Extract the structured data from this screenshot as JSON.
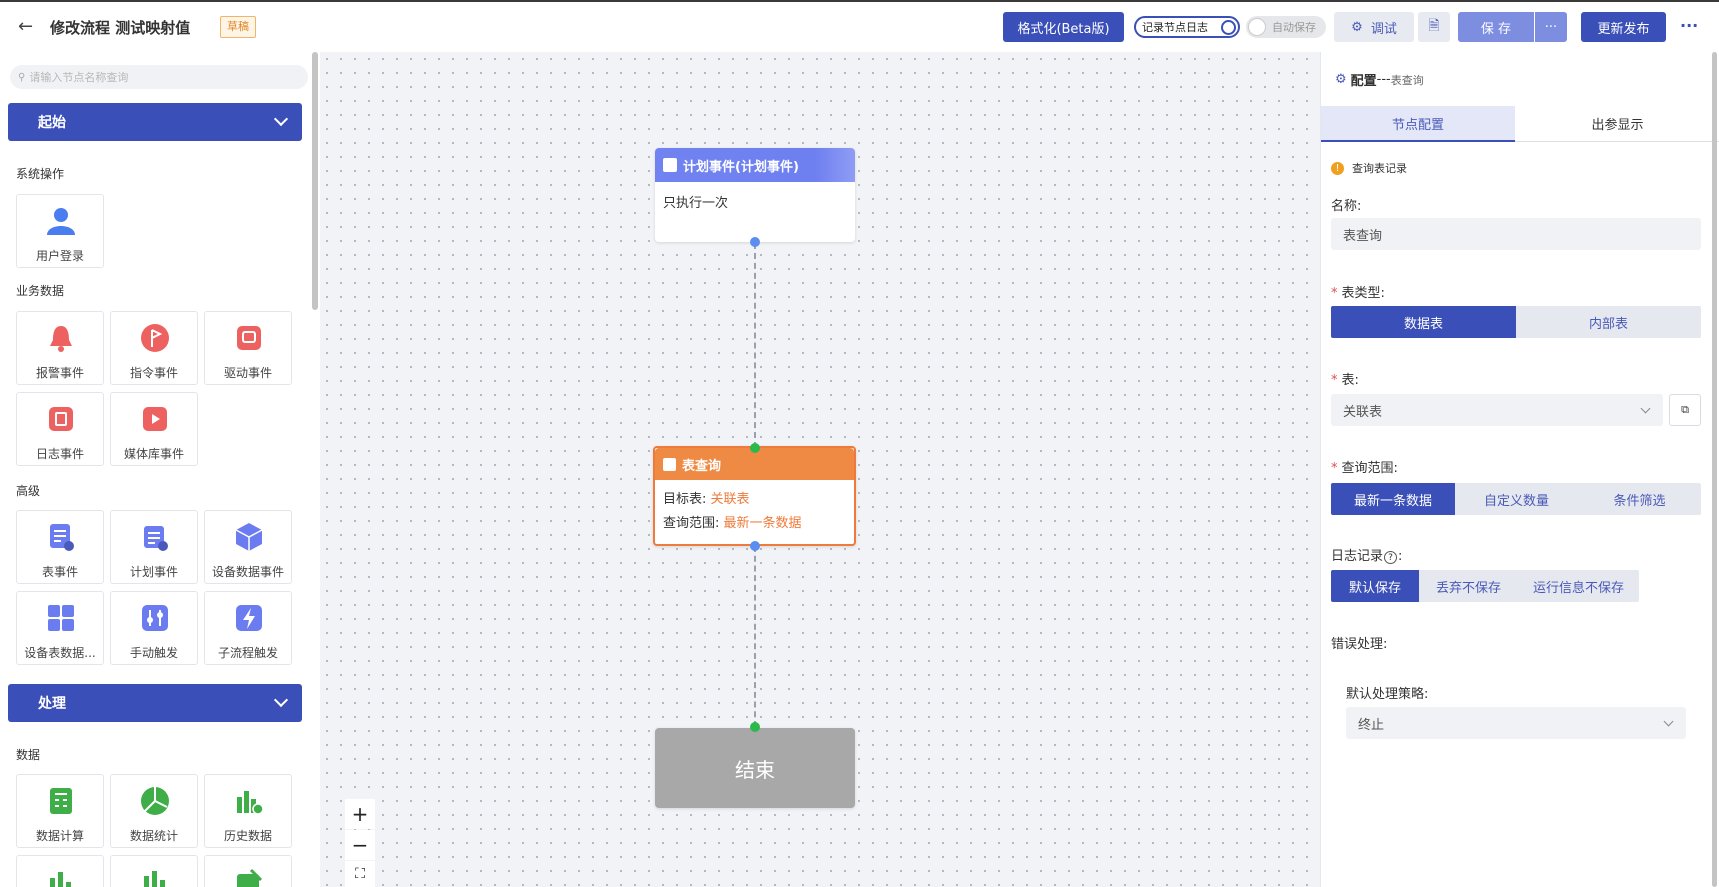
{
  "header": {
    "title": "修改流程 测试映射值",
    "badge": "草稿",
    "format_btn": "格式化(Beta版)",
    "log_toggle": "记录节点日志",
    "autosave_toggle": "自动保存",
    "debug_btn": "调试",
    "save_btn": "保 存",
    "more_btn": "···",
    "publish_btn": "更新发布",
    "overflow": "···"
  },
  "left": {
    "search_placeholder": "请输入节点名称查询",
    "categories": {
      "start": "起始",
      "process": "处理"
    },
    "sections": {
      "system": "系统操作",
      "business": "业务数据",
      "advanced": "高级",
      "data": "数据"
    },
    "tiles": {
      "user_login": "用户登录",
      "alarm_event": "报警事件",
      "command_event": "指令事件",
      "driver_event": "驱动事件",
      "log_event": "日志事件",
      "media_event": "媒体库事件",
      "table_event": "表事件",
      "plan_event": "计划事件",
      "device_data_event": "设备数据事件",
      "device_table_data": "设备表数据...",
      "manual_trigger": "手动触发",
      "subflow_trigger": "子流程触发",
      "data_calc": "数据计算",
      "data_stats": "数据统计",
      "history_data": "历史数据"
    }
  },
  "canvas": {
    "node_plan": {
      "title": "计划事件(计划事件)",
      "body": "只执行一次"
    },
    "node_query": {
      "title": "表查询",
      "target_label": "目标表: ",
      "target_value": "关联表",
      "range_label": "查询范围: ",
      "range_value": "最新一条数据"
    },
    "node_end": {
      "title": "结束"
    },
    "zoom_in": "+",
    "zoom_out": "−"
  },
  "right": {
    "header_title": "配置",
    "header_sep": "---",
    "header_sub": "表查询",
    "tabs": [
      "节点配置",
      "出参显示"
    ],
    "notice": "查询表记录",
    "name_label": "名称:",
    "name_value": "表查询",
    "table_type_label": "表类型:",
    "table_type_options": [
      "数据表",
      "内部表"
    ],
    "table_label": "表:",
    "table_value": "关联表",
    "range_label": "查询范围:",
    "range_options": [
      "最新一条数据",
      "自定义数量",
      "条件筛选"
    ],
    "log_label": "日志记录",
    "log_options": [
      "默认保存",
      "丢弃不保存",
      "运行信息不保存"
    ],
    "error_label": "错误处理:",
    "policy_label": "默认处理策略:",
    "policy_value": "终止"
  },
  "colors": {
    "primary": "#3b4fb8",
    "plan_header": "#6b7cf0",
    "query_header": "#ef8a45",
    "highlight": "#ef7a3b",
    "end_node": "#a8a8a8",
    "dot_blue": "#5b8ef0",
    "dot_green": "#2db84d"
  }
}
